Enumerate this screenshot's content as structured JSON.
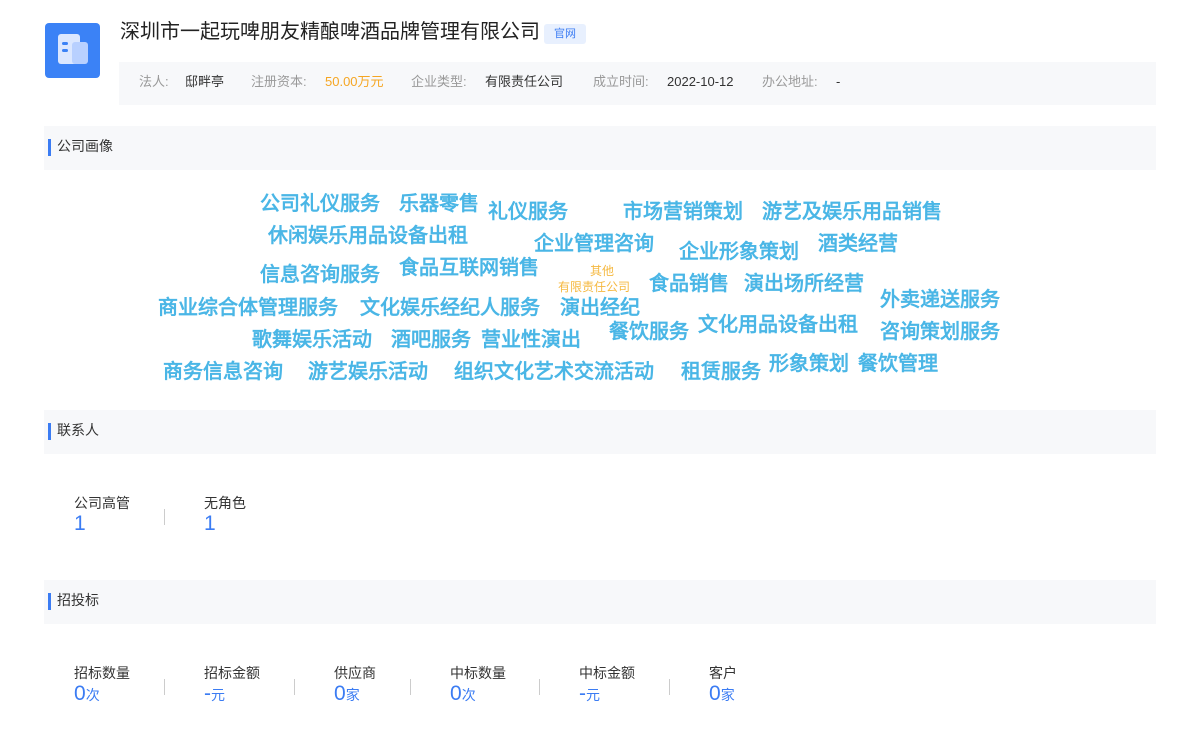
{
  "company": {
    "name": "深圳市一起玩啤朋友精酿啤酒品牌管理有限公司",
    "tag": "官网",
    "info": {
      "legal_rep_label": "法人:",
      "legal_rep": "邸畔亭",
      "capital_label": "注册资本:",
      "capital": "50.00万元",
      "type_label": "企业类型:",
      "type": "有限责任公司",
      "founded_label": "成立时间:",
      "founded": "2022-10-12",
      "address_label": "办公地址:",
      "address": "-"
    }
  },
  "portrait": {
    "title": "公司画像",
    "words": [
      "公司礼仪服务",
      "乐器零售",
      "礼仪服务",
      "市场营销策划",
      "游艺及娱乐用品销售",
      "休闲娱乐用品设备出租",
      "企业管理咨询",
      "企业形象策划",
      "酒类经营",
      "信息咨询服务",
      "食品互联网销售",
      "食品销售",
      "演出场所经营",
      "商业综合体管理服务",
      "文化娱乐经纪人服务",
      "演出经纪",
      "外卖递送服务",
      "歌舞娱乐活动",
      "酒吧服务",
      "营业性演出",
      "餐饮服务",
      "文化用品设备出租",
      "咨询策划服务",
      "商务信息咨询",
      "游艺娱乐活动",
      "组织文化艺术交流活动",
      "租赁服务",
      "形象策划",
      "餐饮管理"
    ],
    "small_words": [
      "其他",
      "有限责任公司"
    ],
    "colors": {
      "word": "#4ab6e6",
      "small": "#f5b942"
    }
  },
  "contacts": {
    "title": "联系人",
    "stats": [
      {
        "label": "公司高管",
        "value": "1"
      },
      {
        "label": "无角色",
        "value": "1"
      }
    ]
  },
  "bidding": {
    "title": "招投标",
    "stats": [
      {
        "label": "招标数量",
        "value": "0",
        "unit": "次"
      },
      {
        "label": "招标金额",
        "value": "-",
        "unit": "元"
      },
      {
        "label": "供应商",
        "value": "0",
        "unit": "家"
      },
      {
        "label": "中标数量",
        "value": "0",
        "unit": "次"
      },
      {
        "label": "中标金额",
        "value": "-",
        "unit": "元"
      },
      {
        "label": "客户",
        "value": "0",
        "unit": "家"
      }
    ]
  },
  "accent_color": "#3b7cf3"
}
